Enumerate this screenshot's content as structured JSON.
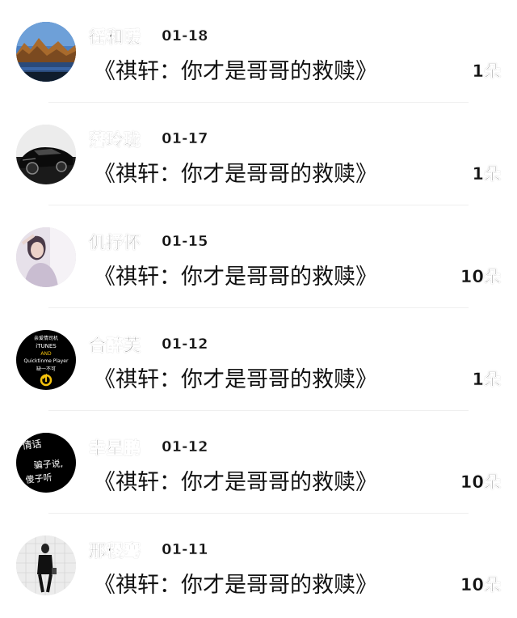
{
  "items": [
    {
      "name": "徭和暖",
      "date": "01-18",
      "title": "《祺轩：你才是哥哥的救赎》",
      "count": "1朵",
      "avatar_icon": "landscape-photo-icon",
      "avatar_colors": [
        "#3a6db0",
        "#c9873a",
        "#1b2a3a"
      ]
    },
    {
      "name": "藩玲珑",
      "date": "01-17",
      "title": "《祺轩：你才是哥哥的救赎》",
      "count": "1朵",
      "avatar_icon": "sports-car-icon",
      "avatar_colors": [
        "#0b0b0b",
        "#e8e8e8",
        "#3a3a3a"
      ]
    },
    {
      "name": "仉抒怀",
      "date": "01-15",
      "title": "《祺轩：你才是哥哥的救赎》",
      "count": "10朵",
      "avatar_icon": "portrait-photo-icon",
      "avatar_colors": [
        "#d9d2dc",
        "#f2eef2",
        "#6b5b6e"
      ]
    },
    {
      "name": "合醉芙",
      "date": "01-12",
      "title": "《祺轩：你才是哥哥的救赎》",
      "count": "1朵",
      "avatar_icon": "text-logo-icon",
      "avatar_colors": [
        "#000000",
        "#ffffff",
        "#f4c20d"
      ],
      "avatar_text": [
        "亲爱情司机",
        "iTUNES",
        "AND",
        "Quicktinme Player",
        "缺一不可"
      ]
    },
    {
      "name": "幸星鹏",
      "date": "01-12",
      "title": "《祺轩：你才是哥哥的救赎》",
      "count": "10朵",
      "avatar_icon": "handwriting-icon",
      "avatar_colors": [
        "#000000",
        "#ffffff"
      ],
      "avatar_text": [
        "情话",
        "骗子说,",
        "傻子听"
      ]
    },
    {
      "name": "邢稷骞",
      "date": "01-11",
      "title": "《祺轩：你才是哥哥的救赎》",
      "count": "10朵",
      "avatar_icon": "person-photo-icon",
      "avatar_colors": [
        "#e9e9e9",
        "#111111",
        "#bdbdbd"
      ]
    }
  ]
}
